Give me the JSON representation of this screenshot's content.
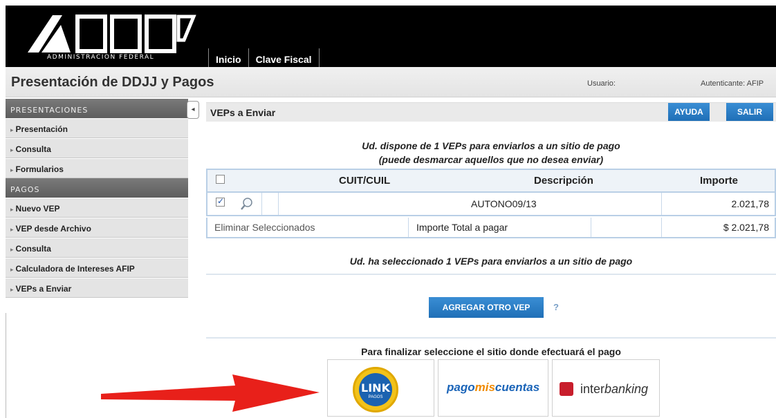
{
  "header": {
    "logo_letters": "AFIP",
    "logo_caption": "ADMINISTRACION FEDERAL",
    "nav": [
      {
        "label": "Inicio"
      },
      {
        "label": "Clave Fiscal"
      }
    ]
  },
  "titlebar": {
    "title": "Presentación de DDJJ y Pagos",
    "user_label": "Usuario:",
    "auth_label": "Autenticante: AFIP"
  },
  "sidebar": {
    "section1_title": "PRESENTACIONES",
    "section1_items": [
      {
        "label": "Presentación"
      },
      {
        "label": "Consulta"
      },
      {
        "label": "Formularios"
      }
    ],
    "section2_title": "PAGOS",
    "section2_items": [
      {
        "label": "Nuevo VEP"
      },
      {
        "label": "VEP desde Archivo"
      },
      {
        "label": "Consulta"
      },
      {
        "label": "Calculadora de Intereses AFIP"
      },
      {
        "label": "VEPs a Enviar"
      }
    ],
    "collapse_glyph": "◂"
  },
  "main": {
    "section_title": "VEPs a Enviar",
    "help_button": "AYUDA",
    "exit_button": "SALIR",
    "info_line1": "Ud. dispone de 1 VEPs para enviarlos a un sitio de pago",
    "info_line2": "(puede desmarcar aquellos que no desea enviar)",
    "table": {
      "headers": [
        "CUIT/CUIL",
        "Descripción",
        "Importe"
      ],
      "rows": [
        {
          "checked": true,
          "cuit": "",
          "descripcion": "AUTONO09/13",
          "importe": "2.021,78"
        }
      ]
    },
    "totals": {
      "delete_link": "Eliminar Seleccionados",
      "total_label": "Importe Total a pagar",
      "total_value": "$ 2.021,78"
    },
    "selected_line": "Ud. ha seleccionado 1 VEPs para enviarlos a un sitio de pago",
    "add_button": "AGREGAR OTRO VEP",
    "help_mark": "?",
    "finalize_text": "Para finalizar seleccione el sitio donde efectuará el pago",
    "payment_sites": {
      "link_word": "LINK",
      "link_sub": "PAGOS",
      "pmc_part1": "pago",
      "pmc_part2": "mis",
      "pmc_part3": "cuentas",
      "ib_part1": "inter",
      "ib_part2": "banking"
    }
  },
  "colors": {
    "accent_blue": "#1f6fb7",
    "arrow_red": "#e8201a",
    "link_yellow": "#f2c21a",
    "pmc_orange": "#f08a00"
  }
}
